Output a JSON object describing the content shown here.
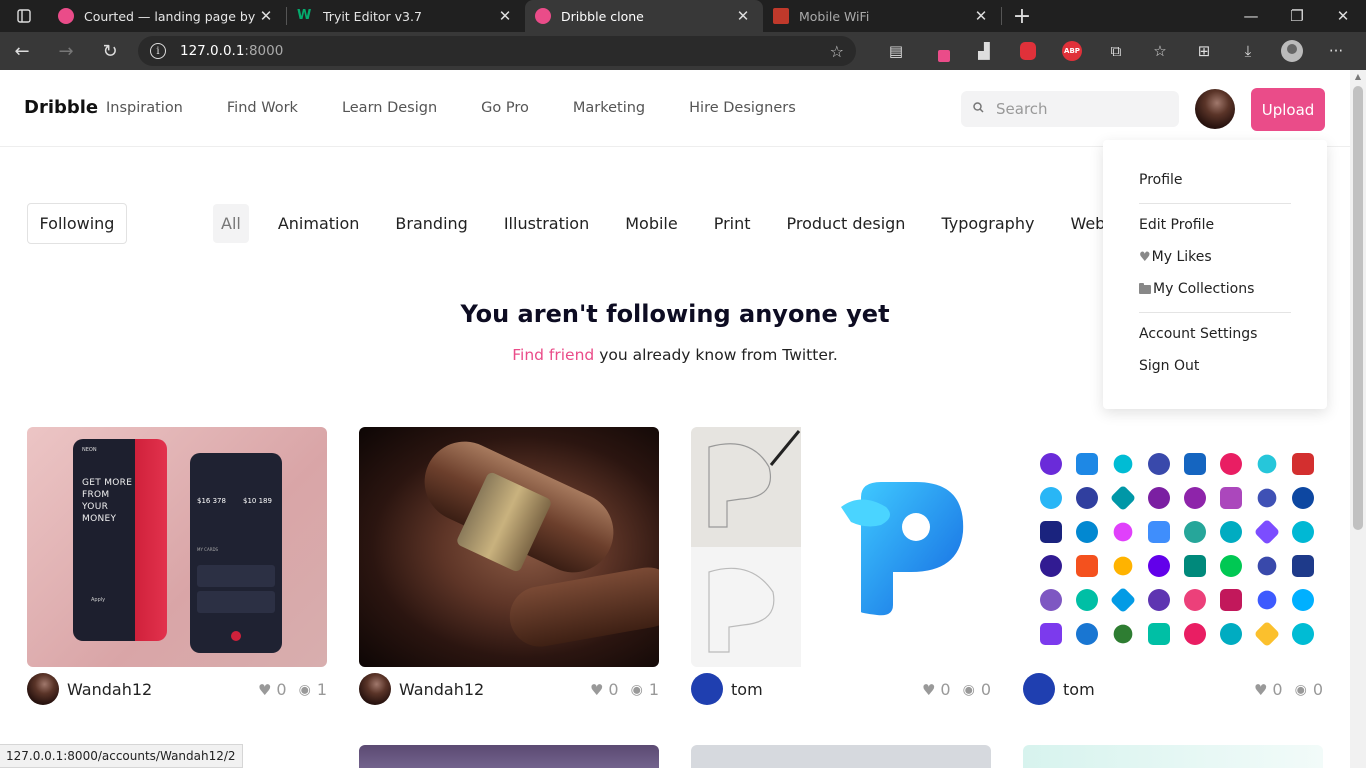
{
  "browser": {
    "tabs": [
      {
        "title": "Courted — landing page by Dam",
        "favicon_color": "#ea4c89",
        "active": false
      },
      {
        "title": "Tryit Editor v3.7",
        "favicon_color": "#04aa6d",
        "active": false
      },
      {
        "title": "Dribble clone",
        "favicon_color": "#ea4c89",
        "active": true
      },
      {
        "title": "Mobile WiFi",
        "favicon_color": "#c0392b",
        "active": false
      }
    ],
    "address": {
      "host": "127.0.0.1",
      "port": ":8000"
    },
    "extensions": {
      "abp_label": "ABP"
    }
  },
  "nav": {
    "logo": "Dribble",
    "links": [
      "Inspiration",
      "Find Work",
      "Learn Design",
      "Go Pro",
      "Marketing",
      "Hire Designers"
    ],
    "search_placeholder": "Search",
    "upload_label": "Upload"
  },
  "filters": {
    "following_label": "Following",
    "categories": [
      "All",
      "Animation",
      "Branding",
      "Illustration",
      "Mobile",
      "Print",
      "Product design",
      "Typography",
      "Web"
    ]
  },
  "empty_state": {
    "title": "You aren't following anyone yet",
    "link": "Find friend",
    "rest": " you already know from Twitter."
  },
  "dropdown": {
    "profile": "Profile",
    "edit_profile": "Edit Profile",
    "my_likes": "My Likes",
    "my_collections": "My Collections",
    "account_settings": "Account Settings",
    "sign_out": "Sign Out"
  },
  "shots": [
    {
      "user": "Wandah12",
      "likes": "0",
      "views": "1"
    },
    {
      "user": "Wandah12",
      "likes": "0",
      "views": "1"
    },
    {
      "user": "tom",
      "likes": "0",
      "views": "0"
    },
    {
      "user": "tom",
      "likes": "0",
      "views": "0"
    }
  ],
  "neon_mockup": {
    "brand": "NEON",
    "headline": "GET MORE FROM YOUR MONEY",
    "balance_1": "$16 378",
    "balance_2": "$10 189",
    "cards_label": "MY CARDS",
    "apply": "Apply"
  },
  "status_url": "127.0.0.1:8000/accounts/Wandah12/2",
  "colors": {
    "accent": "#ea4c89",
    "tom_avatar": "#1f3fb0"
  }
}
